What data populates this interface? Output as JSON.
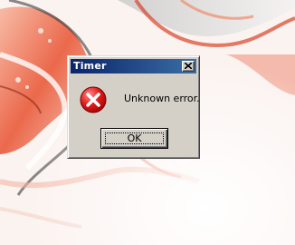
{
  "dialog": {
    "title": "Timer",
    "message": "Unknown error.",
    "ok_label": "OK",
    "icon": "error-icon",
    "close_icon": "close-icon"
  },
  "colors": {
    "titlebar_start": "#0a246a",
    "titlebar_end": "#3a6ea5",
    "dialog_face": "#d4d0c8",
    "error_red": "#e01c1c",
    "wallpaper_accent": "#e8502e"
  }
}
